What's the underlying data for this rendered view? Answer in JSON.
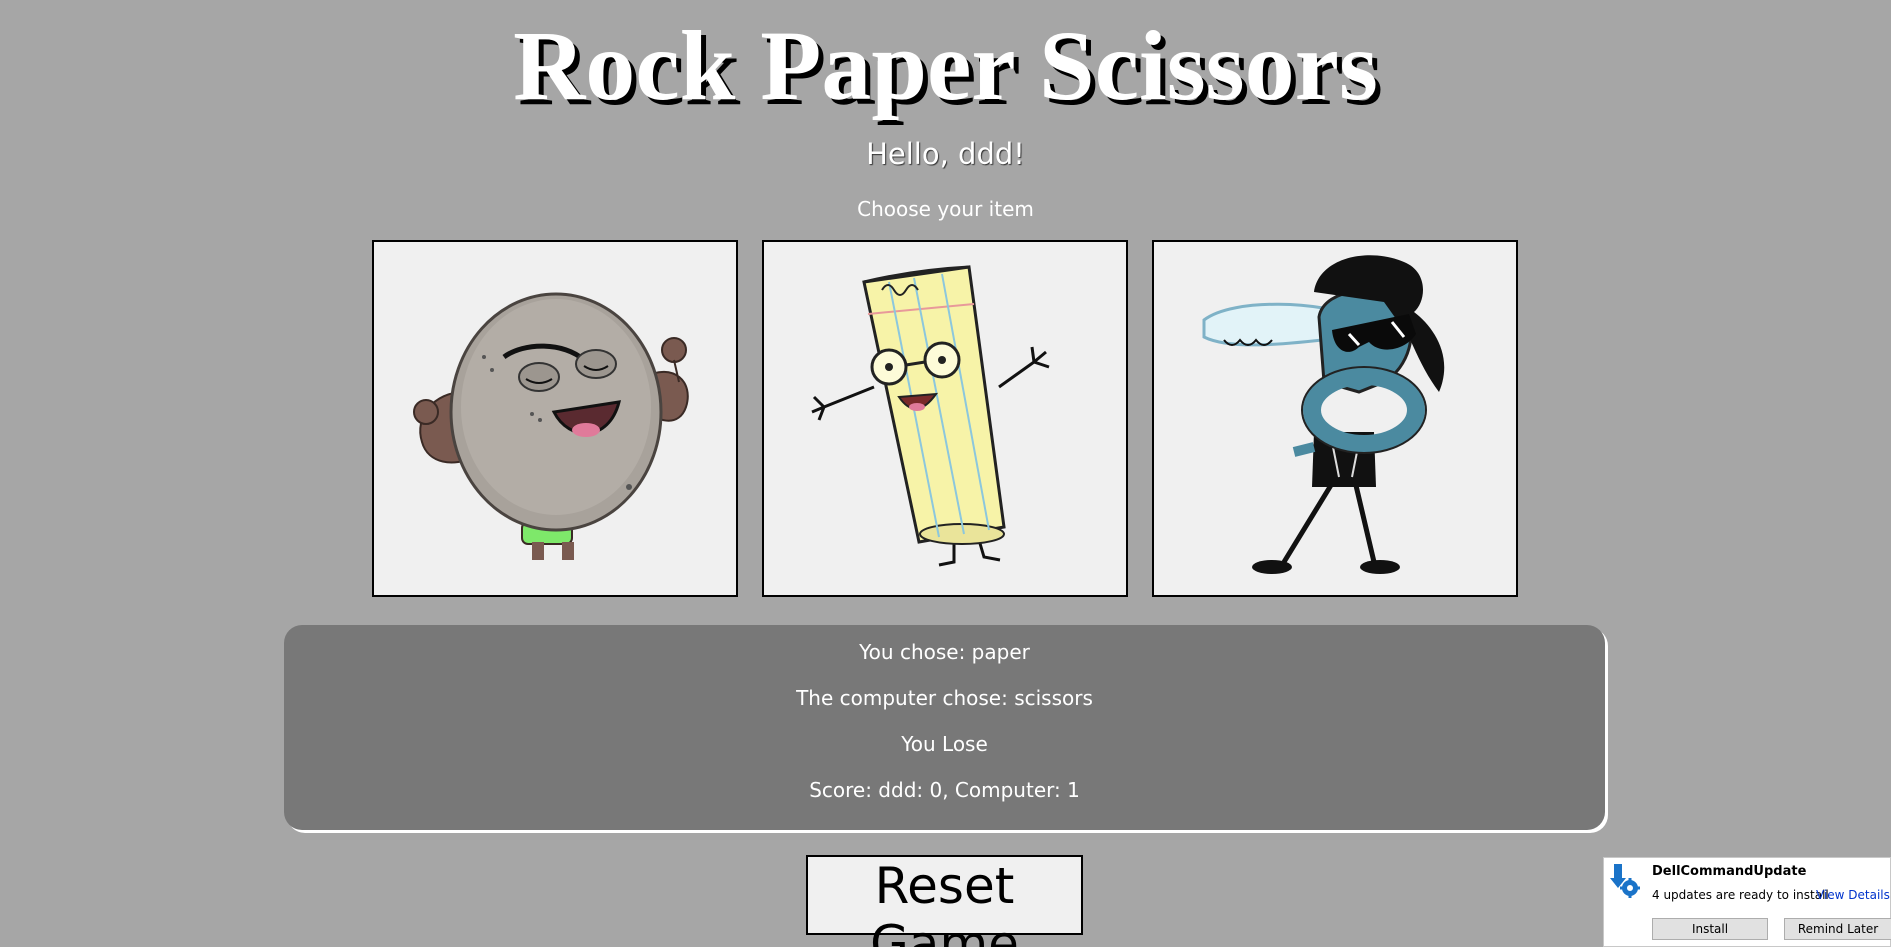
{
  "header": {
    "title": "Rock Paper Scissors",
    "greeting": "Hello, ddd!",
    "prompt": "Choose your item"
  },
  "choices": [
    {
      "id": "rock",
      "icon": "rock-character-icon"
    },
    {
      "id": "paper",
      "icon": "paper-character-icon"
    },
    {
      "id": "scissors",
      "icon": "scissors-character-icon"
    }
  ],
  "result": {
    "you_chose": "You chose: paper",
    "computer_chose": "The computer chose: scissors",
    "outcome": "You Lose",
    "score": "Score: ddd: 0, Computer: 1"
  },
  "reset_label": "Reset Game",
  "notification": {
    "app_name": "DellCommandUpdate",
    "message": "4 updates are ready to install",
    "link_label": "View Details",
    "install_label": "Install",
    "remind_label": "Remind Later",
    "icon": "dell-update-icon"
  },
  "colors": {
    "background": "#a6a6a6",
    "card_background": "#f0f0f0",
    "result_panel": "#787878",
    "text": "#ffffff"
  }
}
